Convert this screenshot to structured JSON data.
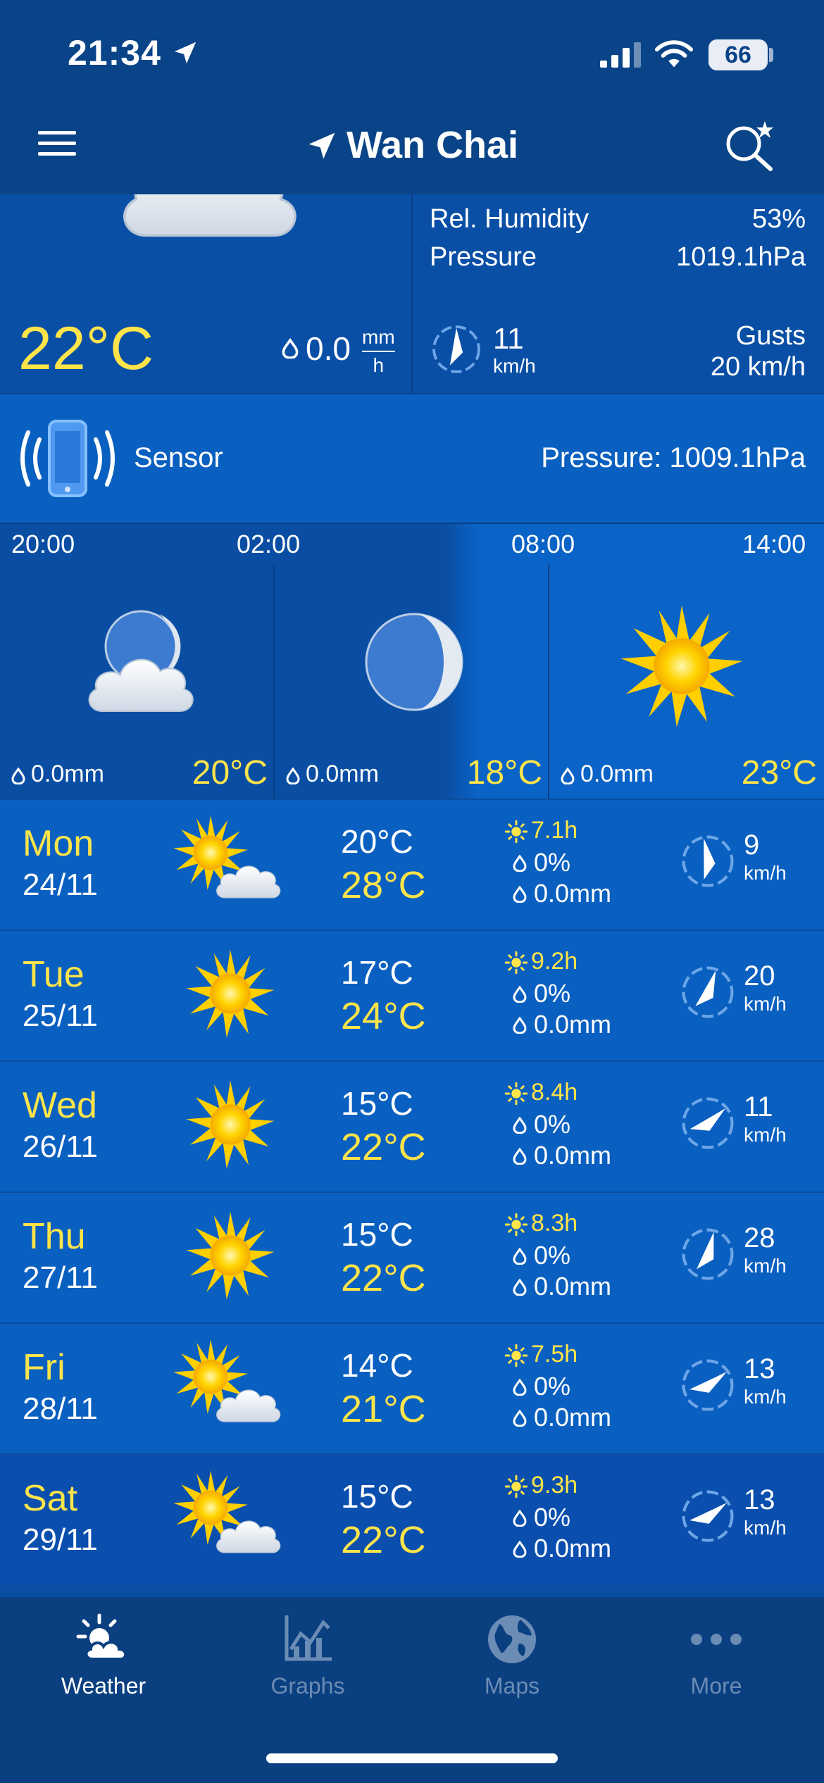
{
  "status_bar": {
    "time": "21:34",
    "battery": "66"
  },
  "header": {
    "location": "Wan Chai"
  },
  "current": {
    "temperature": "22°C",
    "rain": "0.0",
    "rain_unit_top": "mm",
    "rain_unit_bottom": "h",
    "humidity_label": "Rel. Humidity",
    "humidity_value": "53%",
    "pressure_label": "Pressure",
    "pressure_value": "1019.1hPa",
    "wind_speed": "11",
    "wind_unit": "km/h",
    "gusts_label": "Gusts",
    "gusts_value": "20 km/h"
  },
  "sensor": {
    "label": "Sensor",
    "pressure": "Pressure: 1009.1hPa"
  },
  "hourly": [
    {
      "time": "20:00",
      "rain": "0.0mm",
      "temp": "20°C",
      "icon": "moon-cloud-icon"
    },
    {
      "time": "02:00",
      "rain": "0.0mm",
      "temp": "18°C",
      "icon": "moon-icon"
    },
    {
      "time": "08:00",
      "rain": "0.0mm",
      "temp": "23°C",
      "icon": "sun-icon"
    },
    {
      "time": "14:00"
    }
  ],
  "daily": [
    {
      "day": "Mon",
      "date": "24/11",
      "min": "20°C",
      "max": "28°C",
      "sun": "7.1h",
      "prob": "0%",
      "rain": "0.0mm",
      "wind": "9",
      "wind_unit": "km/h",
      "icon": "sun-cloud-icon"
    },
    {
      "day": "Tue",
      "date": "25/11",
      "min": "17°C",
      "max": "24°C",
      "sun": "9.2h",
      "prob": "0%",
      "rain": "0.0mm",
      "wind": "20",
      "wind_unit": "km/h",
      "icon": "sun-icon"
    },
    {
      "day": "Wed",
      "date": "26/11",
      "min": "15°C",
      "max": "22°C",
      "sun": "8.4h",
      "prob": "0%",
      "rain": "0.0mm",
      "wind": "11",
      "wind_unit": "km/h",
      "icon": "sun-icon"
    },
    {
      "day": "Thu",
      "date": "27/11",
      "min": "15°C",
      "max": "22°C",
      "sun": "8.3h",
      "prob": "0%",
      "rain": "0.0mm",
      "wind": "28",
      "wind_unit": "km/h",
      "icon": "sun-icon"
    },
    {
      "day": "Fri",
      "date": "28/11",
      "min": "14°C",
      "max": "21°C",
      "sun": "7.5h",
      "prob": "0%",
      "rain": "0.0mm",
      "wind": "13",
      "wind_unit": "km/h",
      "icon": "sun-cloud-icon"
    },
    {
      "day": "Sat",
      "date": "29/11",
      "min": "15°C",
      "max": "22°C",
      "sun": "9.3h",
      "prob": "0%",
      "rain": "0.0mm",
      "wind": "13",
      "wind_unit": "km/h",
      "icon": "sun-cloud-icon"
    }
  ],
  "tabs": [
    {
      "label": "Weather",
      "active": true
    },
    {
      "label": "Graphs",
      "active": false
    },
    {
      "label": "Maps",
      "active": false
    },
    {
      "label": "More",
      "active": false
    }
  ],
  "colors": {
    "accent_yellow": "#ffe44a",
    "header_bg": "#0a4488",
    "row_bg": "#0a60c0"
  }
}
